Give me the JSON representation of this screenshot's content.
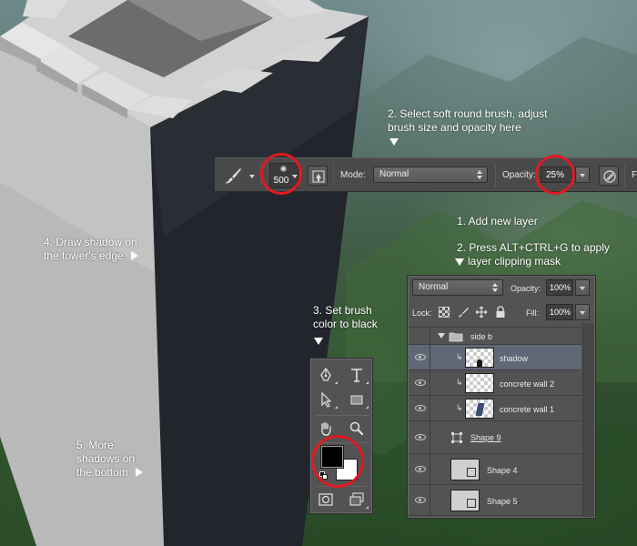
{
  "callouts": {
    "step1": "1. Add new layer",
    "step2_line1": "2. Press ALT+CTRL+G to apply",
    "step2_line2": "layer clipping mask",
    "brush_line1": "2. Select soft round brush, adjust",
    "brush_line2": "brush size and opacity here",
    "step3_line1": "3. Set brush",
    "step3_line2": "color to black",
    "step4_line1": "4. Draw shadow on",
    "step4_line2": "the tower's edge",
    "step5_line1": "5. More",
    "step5_line2": "shadows on",
    "step5_line3": "the bottom"
  },
  "options_bar": {
    "brush_size": "500",
    "mode_label": "Mode:",
    "mode_value": "Normal",
    "opacity_label": "Opacity:",
    "opacity_value": "25%",
    "truncated_label": "F"
  },
  "layers_panel": {
    "blend_mode": "Normal",
    "opacity_label": "Opacity:",
    "opacity_value": "100%",
    "lock_label": "Lock:",
    "fill_label": "Fill:",
    "fill_value": "100%",
    "group_name": "side b",
    "layers": [
      {
        "name": "shadow",
        "selected": true
      },
      {
        "name": "concrete wall 2",
        "selected": false
      },
      {
        "name": "concrete wall 1",
        "selected": false
      },
      {
        "name": "Shape 9",
        "selected": false
      },
      {
        "name": "Shape 4",
        "selected": false
      },
      {
        "name": "Shape 5",
        "selected": false
      }
    ]
  },
  "colors": {
    "highlight_ring": "#e01a22",
    "panel_bg": "#535353",
    "selected_row": "#5f6876",
    "foreground_swatch": "#000000",
    "background_swatch": "#ffffff"
  },
  "icons": {
    "brush": "brush-icon",
    "brush_presets": "brush-panel-icon",
    "airbrush": "airbrush-icon",
    "pen": "pen-tool-icon",
    "type": "type-tool-icon",
    "path_select": "path-selection-icon",
    "rectangle": "rectangle-tool-icon",
    "hand": "hand-tool-icon",
    "zoom": "zoom-tool-icon",
    "quick_mask": "quick-mask-icon",
    "screen_mode": "screen-mode-icon"
  }
}
